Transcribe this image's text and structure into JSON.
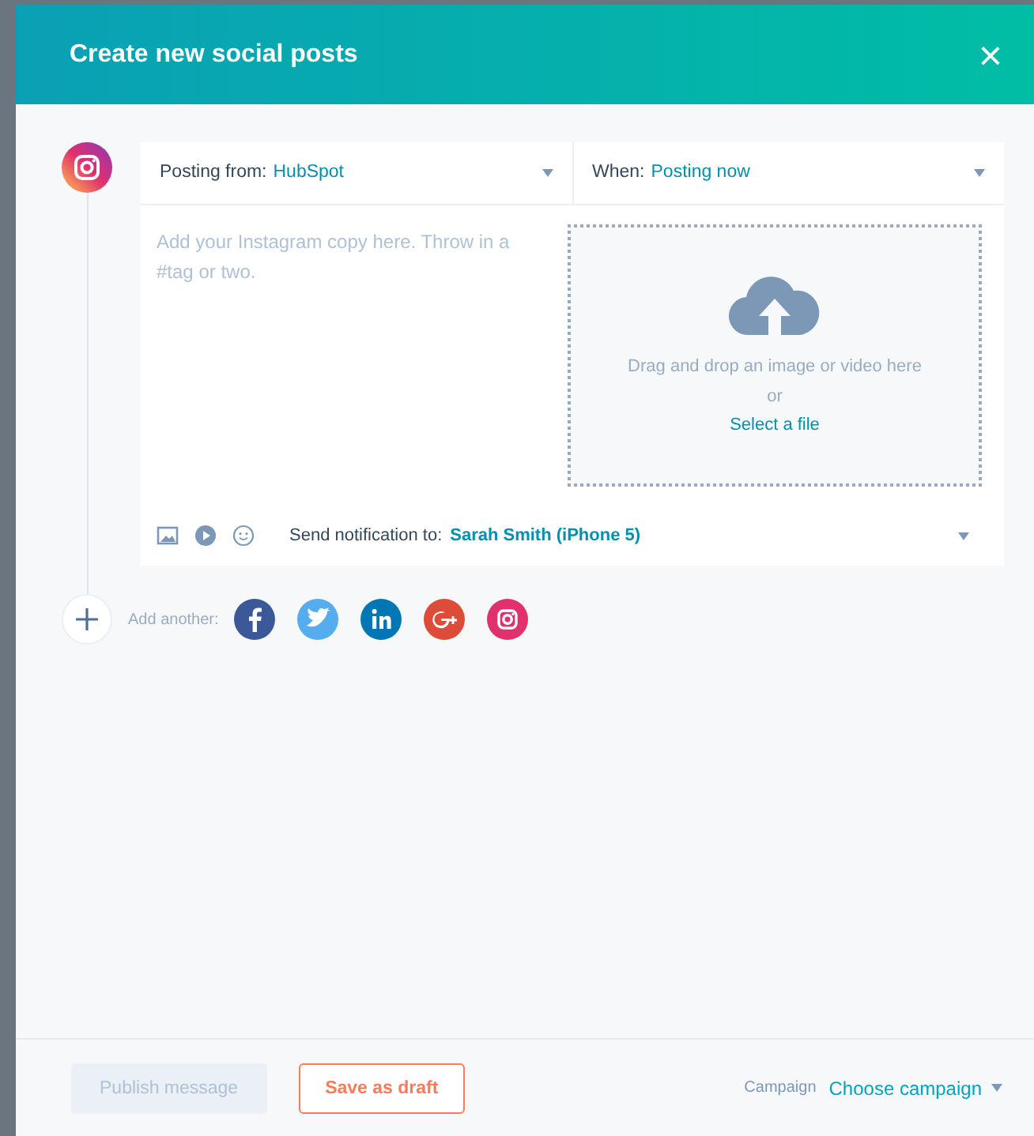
{
  "dialog": {
    "title": "Create new social posts",
    "close": "×"
  },
  "post": {
    "posting_from": {
      "label": "Posting from:",
      "value": "HubSpot"
    },
    "when": {
      "label": "When:",
      "value": "Posting now"
    },
    "copy": {
      "placeholder": "Add your Instagram copy here. Throw in a #tag or two."
    },
    "upload": {
      "hint": "Drag and drop an image or video here",
      "or": "or",
      "link": "Select a file"
    },
    "notification": {
      "label": "Send notification to:",
      "value": "Sarah Smith (iPhone 5)"
    }
  },
  "add_another": {
    "label": "Add another:",
    "networks": [
      {
        "kind": "facebook",
        "color": "#3b5998"
      },
      {
        "kind": "twitter",
        "color": "#55acee"
      },
      {
        "kind": "linkedin",
        "color": "#0077b5"
      },
      {
        "kind": "googleplus",
        "color": "#dd4b39"
      },
      {
        "kind": "instagram",
        "color": "#e1306c"
      }
    ]
  },
  "footer": {
    "publish": {
      "label": "Publish message",
      "disabled": true
    },
    "draft": {
      "label": "Save as draft"
    },
    "campaign": {
      "label": "Campaign",
      "value": "Choose campaign"
    }
  }
}
